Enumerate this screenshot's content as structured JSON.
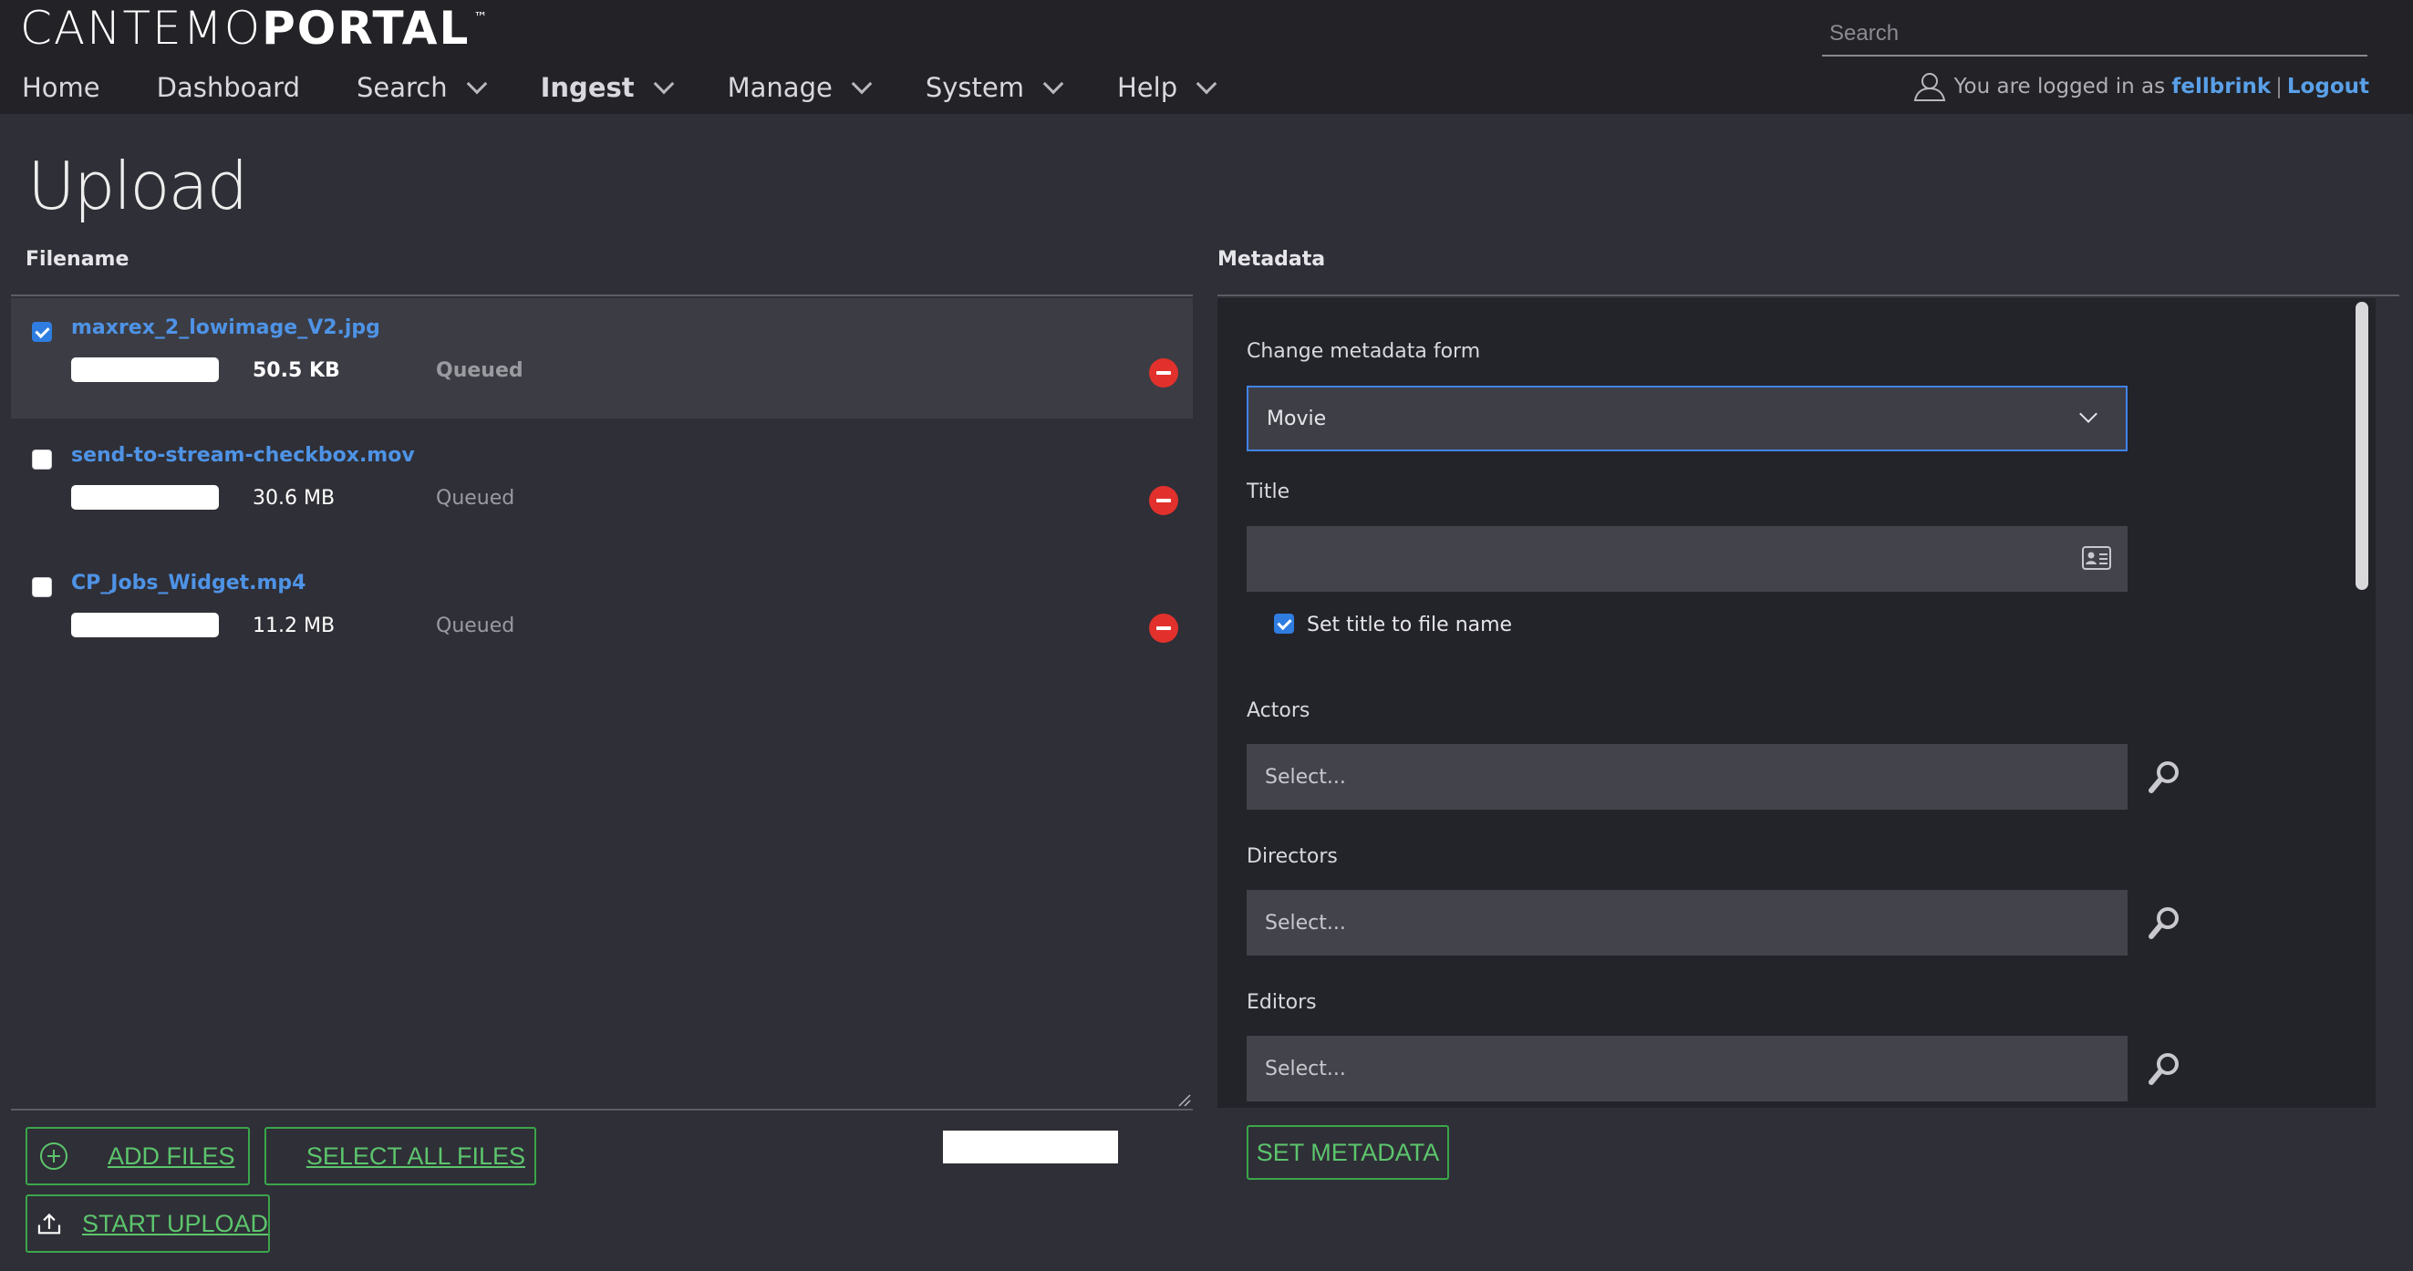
{
  "brand": {
    "thin": "CANTEMO",
    "bold": "PORTAL",
    "tm": "™"
  },
  "header": {
    "search_placeholder": "Search"
  },
  "nav": {
    "items": [
      {
        "label": "Home",
        "dropdown": false,
        "active": false
      },
      {
        "label": "Dashboard",
        "dropdown": false,
        "active": false
      },
      {
        "label": "Search",
        "dropdown": true,
        "active": false
      },
      {
        "label": "Ingest",
        "dropdown": true,
        "active": true
      },
      {
        "label": "Manage",
        "dropdown": true,
        "active": false
      },
      {
        "label": "System",
        "dropdown": true,
        "active": false
      },
      {
        "label": "Help",
        "dropdown": true,
        "active": false
      }
    ]
  },
  "user": {
    "prefix": "You are logged in as",
    "username": "fellbrink",
    "separator": "|",
    "logout": "Logout"
  },
  "page": {
    "title": "Upload"
  },
  "files_panel": {
    "header": "Filename",
    "files": [
      {
        "name": "maxrex_2_lowimage_V2.jpg",
        "size": "50.5 KB",
        "status": "Queued",
        "checked": true,
        "progress_pct": 0
      },
      {
        "name": "send-to-stream-checkbox.mov",
        "size": "30.6 MB",
        "status": "Queued",
        "checked": false,
        "progress_pct": 0
      },
      {
        "name": "CP_Jobs_Widget.mp4",
        "size": "11.2 MB",
        "status": "Queued",
        "checked": false,
        "progress_pct": 0
      }
    ],
    "add_files": "ADD FILES",
    "select_all": "SELECT ALL FILES",
    "start_upload": "START UPLOAD"
  },
  "metadata_panel": {
    "header": "Metadata",
    "form_label": "Change metadata form",
    "form_value": "Movie",
    "title_label": "Title",
    "title_value": "",
    "set_title_label": "Set title to file name",
    "set_title_checked": true,
    "actors_label": "Actors",
    "actors_placeholder": "Select...",
    "directors_label": "Directors",
    "directors_placeholder": "Select...",
    "editors_label": "Editors",
    "editors_placeholder": "Select...",
    "set_metadata": "SET METADATA"
  },
  "colors": {
    "accent_blue": "#4e93e6",
    "accent_green": "#3aa64a",
    "remove_red": "#e2312c",
    "background": "#2f2f37",
    "topbar": "#222227"
  }
}
